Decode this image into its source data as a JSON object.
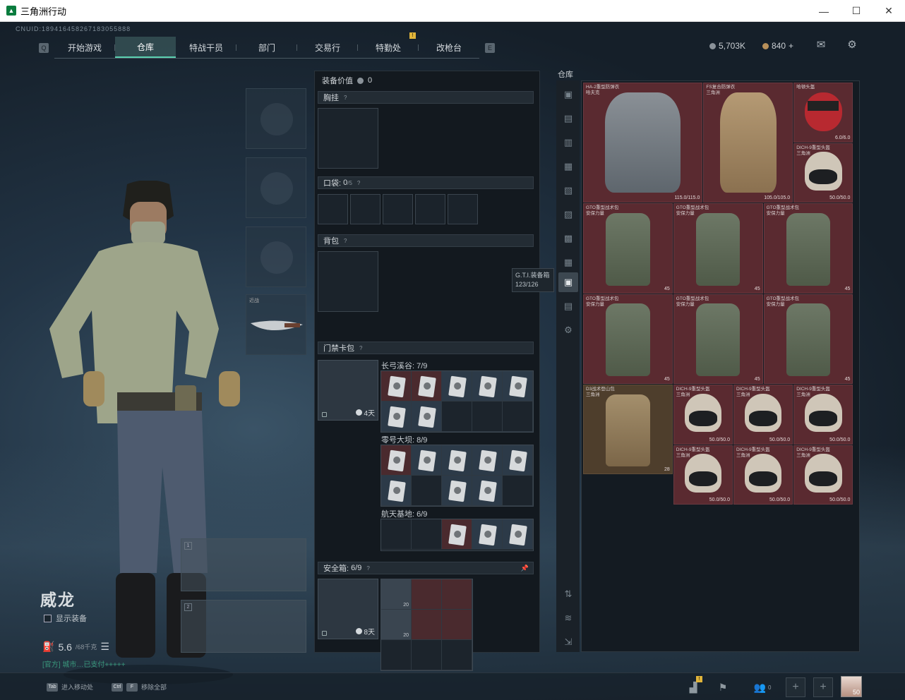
{
  "window": {
    "title": "三角洲行动",
    "minimize": "—",
    "maximize": "☐",
    "close": "✕"
  },
  "uid": "CNUID:189416458267183055888",
  "nav": {
    "prev_key": "Q",
    "next_key": "E",
    "tabs": [
      "开始游戏",
      "仓库",
      "特战干员",
      "部门",
      "交易行",
      "特勤处",
      "改枪台"
    ],
    "active_tab": 1,
    "tab_notice": "!"
  },
  "currency": {
    "silver": "5,703K",
    "gold": "840",
    "gold_add": "+"
  },
  "character": {
    "name": "威龙",
    "show_equipment_label": "显示装备",
    "weight": "5.6",
    "weight_unit": "/68千克",
    "notice": "[官方] 城市…已支付+++++",
    "knife_label": "近战",
    "weapon_slot_1": "1",
    "weapon_slot_2": "2"
  },
  "gear": {
    "value_label": "装备价值",
    "value": "0",
    "chest_rig": "胸挂",
    "pockets": "口袋:",
    "pockets_count": "0",
    "pockets_max": "/5",
    "backpack": "背包",
    "keycard": "门禁卡包",
    "keycard_days": "4天",
    "maps": [
      {
        "label": "长弓溪谷: 7/9"
      },
      {
        "label": "零号大坝: 8/9"
      },
      {
        "label": "航天基地: 6/9"
      }
    ],
    "safebox": "安全箱:",
    "safebox_count": "6/9",
    "safebox_days": "8天",
    "safe_items": [
      "20",
      "20"
    ]
  },
  "stash": {
    "title": "仓库",
    "tooltip_name": "G.T.I.装备箱",
    "tooltip_cap": "123/126",
    "items": [
      {
        "name": "HA-2重型防弹衣\n哈夫克",
        "value": "115.0/115.0"
      },
      {
        "name": "FS复合防弹衣\n三角洲",
        "value": "105.0/105.0"
      },
      {
        "name": "哈顿头盔",
        "value": "6.0/6.0"
      },
      {
        "name": "DICH-9重型头盔\n三角洲",
        "value": "50.0/50.0"
      },
      {
        "name": "GTO重型战术包\n安保力量",
        "value": "45"
      },
      {
        "name": "GTO重型战术包\n安保力量",
        "value": "45"
      },
      {
        "name": "GTO重型战术包\n安保力量",
        "value": "45"
      },
      {
        "name": "GTO重型战术包\n安保力量",
        "value": "45"
      },
      {
        "name": "GTO重型战术包\n安保力量",
        "value": "45"
      },
      {
        "name": "GTO重型战术包\n安保力量",
        "value": "45"
      },
      {
        "name": "D3战术登山包\n三角洲",
        "value": "28"
      },
      {
        "name": "DICH-9重型头盔\n三角洲",
        "value": "50.0/50.0"
      },
      {
        "name": "DICH-9重型头盔\n三角洲",
        "value": "50.0/50.0"
      },
      {
        "name": "DICH-9重型头盔\n三角洲",
        "value": "50.0/50.0"
      },
      {
        "name": "DICH-9重型头盔\n三角洲",
        "value": "50.0/50.0"
      },
      {
        "name": "DICH-9重型头盔\n三角洲",
        "value": "50.0/50.0"
      },
      {
        "name": "DICH-9重型头盔\n三角洲",
        "value": "50.0/50.0"
      }
    ]
  },
  "bottom": {
    "hint1_key": "Tab",
    "hint1": "进入移动处",
    "hint2_key": "Ctrl",
    "hint2_key2": "F",
    "hint2": "移除全部",
    "friends": "0",
    "avatar_level": "50"
  }
}
